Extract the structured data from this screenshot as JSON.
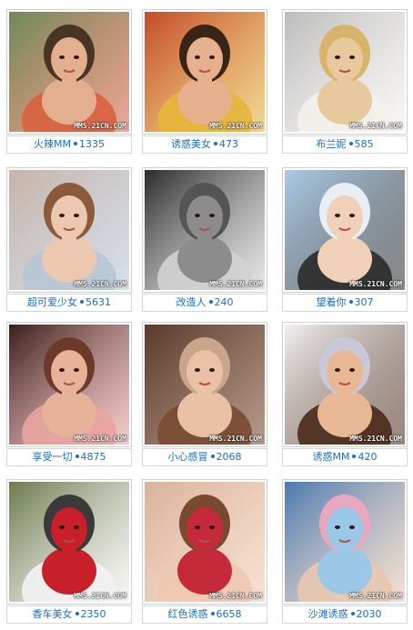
{
  "watermark": "MMS.21CN.COM",
  "items": [
    {
      "name": "火辣MM",
      "count": "1335",
      "palette": [
        "#6f8a5a",
        "#e3b08f",
        "#d9603e",
        "#4a3424"
      ]
    },
    {
      "name": "诱惑美女",
      "count": "473",
      "palette": [
        "#c44a2a",
        "#e6b18c",
        "#e7b53a",
        "#3a2418"
      ]
    },
    {
      "name": "布兰妮",
      "count": "585",
      "palette": [
        "#bcbcbc",
        "#e8c99e",
        "#f4f0ea",
        "#d8b36a"
      ]
    },
    {
      "name": "超可爱少女",
      "count": "5631",
      "palette": [
        "#c8b3a8",
        "#ecc8b0",
        "#b7c6d6",
        "#8a5a3a"
      ]
    },
    {
      "name": "改造人",
      "count": "240",
      "palette": [
        "#2a2a2a",
        "#8c8c8c",
        "#d2d2d2",
        "#555555"
      ]
    },
    {
      "name": "望着你",
      "count": "307",
      "palette": [
        "#a9cbe8",
        "#f0d0b8",
        "#2a2a2a",
        "#e9eef4"
      ]
    },
    {
      "name": "享受一切",
      "count": "4875",
      "palette": [
        "#3a1e1a",
        "#e7b29a",
        "#e9a3a0",
        "#6b3a2a"
      ]
    },
    {
      "name": "小心感冒",
      "count": "2068",
      "palette": [
        "#5a3a2a",
        "#e9c1a6",
        "#7a4a32",
        "#c9a58c"
      ]
    },
    {
      "name": "诱惑MM",
      "count": "420",
      "palette": [
        "#f2f2f2",
        "#e8b894",
        "#4a2a1a",
        "#c8c8d8"
      ]
    },
    {
      "name": "香车美女",
      "count": "2350",
      "palette": [
        "#6b7a4a",
        "#c8202a",
        "#f2f2f2",
        "#3a3a3a"
      ]
    },
    {
      "name": "红色诱惑",
      "count": "6658",
      "palette": [
        "#d9b39a",
        "#c42a3a",
        "#f0c8b0",
        "#7a4a30"
      ]
    },
    {
      "name": "沙滩诱惑",
      "count": "2030",
      "palette": [
        "#4a7ab0",
        "#9cc8e8",
        "#e8c8b0",
        "#e8a8c0"
      ]
    }
  ]
}
